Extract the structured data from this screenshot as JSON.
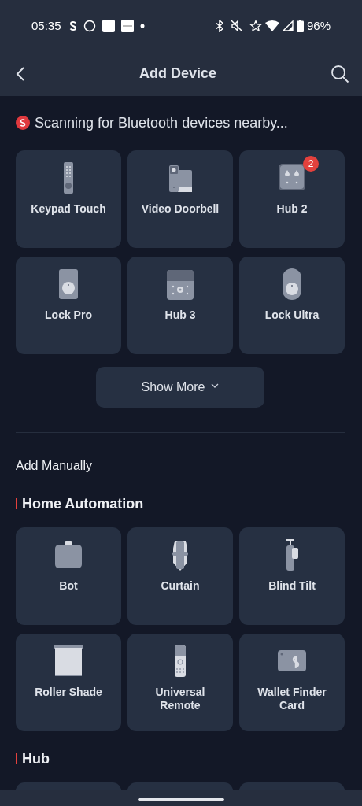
{
  "status_bar": {
    "time": "05:35",
    "battery": "96%"
  },
  "header": {
    "title": "Add Device"
  },
  "scanning": {
    "text": "Scanning for Bluetooth devices nearby..."
  },
  "nearby_devices": [
    {
      "kind": "keypad",
      "label": "Keypad Touch"
    },
    {
      "kind": "doorbell",
      "label": "Video Doorbell"
    },
    {
      "kind": "hub2",
      "label": "Hub 2",
      "badge": "2"
    },
    {
      "kind": "lock",
      "label": "Lock Pro"
    },
    {
      "kind": "hub3",
      "label": "Hub 3"
    },
    {
      "kind": "lock-round",
      "label": "Lock Ultra"
    }
  ],
  "show_more": {
    "label": "Show More"
  },
  "manual": {
    "title": "Add Manually",
    "sections": [
      {
        "title": "Home Automation",
        "devices": [
          {
            "kind": "bot",
            "label": "Bot"
          },
          {
            "kind": "curtain",
            "label": "Curtain"
          },
          {
            "kind": "blind-tilt",
            "label": "Blind Tilt"
          },
          {
            "kind": "roller-shade",
            "label": "Roller Shade"
          },
          {
            "kind": "remote",
            "label": "Universal Remote"
          },
          {
            "kind": "card",
            "label": "Wallet Finder Card"
          }
        ]
      },
      {
        "title": "Hub",
        "devices": [
          {
            "kind": "cut-off"
          },
          {
            "kind": "cut-off"
          },
          {
            "kind": "cut-off"
          }
        ]
      }
    ]
  }
}
